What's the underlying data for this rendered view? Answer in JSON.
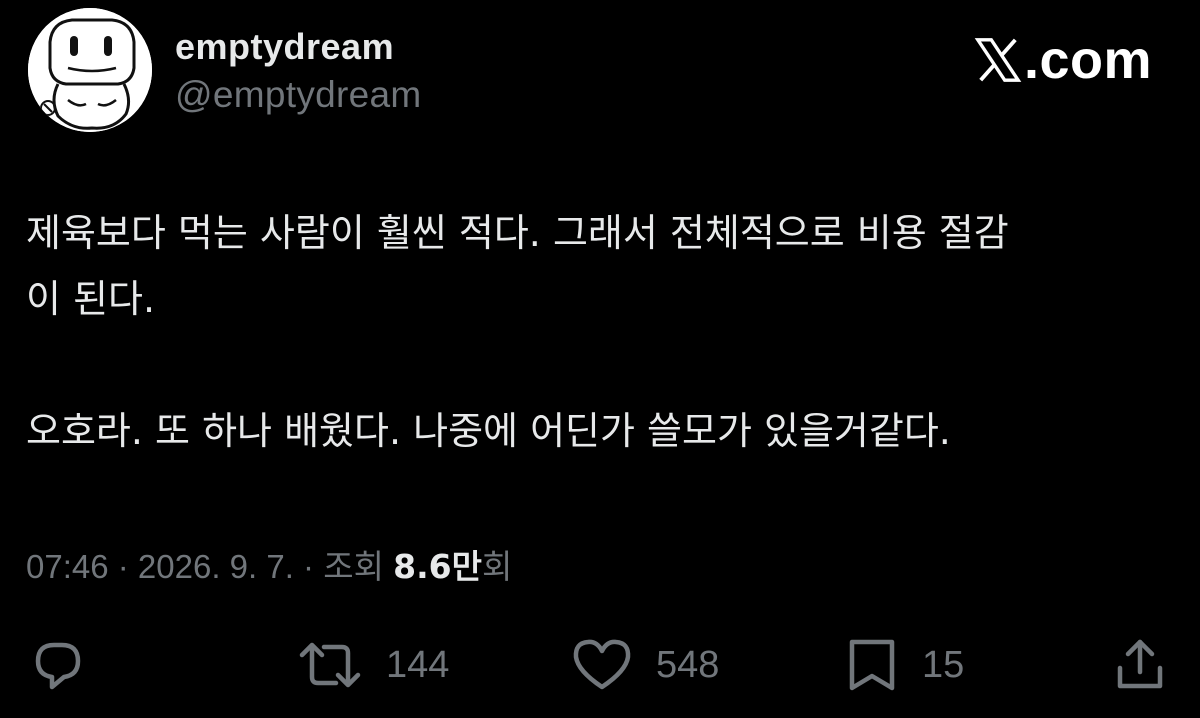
{
  "profile": {
    "display_name": "emptydream",
    "handle": "@emptydream",
    "avatar_icon": "cartoon-face-avatar"
  },
  "brand": {
    "text": ".com",
    "icon": "x-logo-icon"
  },
  "tweet": {
    "text": "제육보다 먹는 사람이 훨씬 적다. 그래서 전체적으로 비용 절감\n이 된다.\n\n오호라. 또 하나 배웠다. 나중에 어딘가 쓸모가 있을거같다."
  },
  "meta": {
    "time": "07:46",
    "separator": " · ",
    "date": "2026. 9. 7.",
    "views_label": "조회 ",
    "views_count": "8.6만",
    "views_unit": "회"
  },
  "actions": {
    "reply_icon": "reply-icon",
    "retweet_icon": "retweet-icon",
    "retweets": "144",
    "like_icon": "heart-icon",
    "likes": "548",
    "bookmark_icon": "bookmark-icon",
    "bookmarks": "15",
    "share_icon": "share-icon"
  },
  "colors": {
    "background": "#000000",
    "primary_text": "#e7e9ea",
    "secondary_text": "#71767b"
  }
}
